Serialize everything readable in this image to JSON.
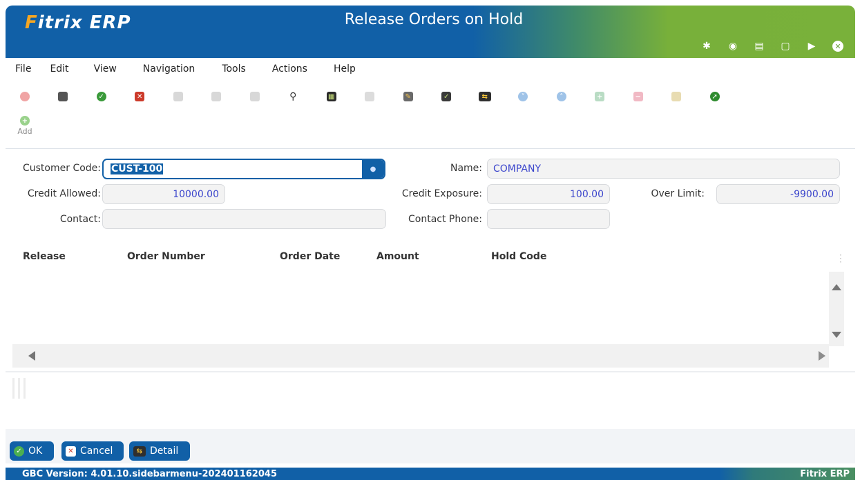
{
  "app": {
    "logo_part1": "F",
    "logo_part2": "itrix ERP",
    "window_title": "Release Orders on Hold"
  },
  "titlebar_icons": [
    "gear-icon",
    "target-icon",
    "document-icon",
    "page-icon",
    "play-icon",
    "close-icon"
  ],
  "menu": {
    "items": [
      "File",
      "Edit",
      "View",
      "Navigation",
      "Tools",
      "Actions",
      "Help"
    ]
  },
  "toolbar": {
    "icons": [
      {
        "name": "cancel-disabled-icon",
        "color": "#f0a4a4"
      },
      {
        "name": "window-icon",
        "color": "#444"
      },
      {
        "name": "accept-icon",
        "color": "#3a9a3a"
      },
      {
        "name": "cancel-icon",
        "color": "#cc3a2a"
      },
      {
        "name": "copy-icon",
        "color": "#c9c9c9"
      },
      {
        "name": "paste-icon",
        "color": "#c9c9c9"
      },
      {
        "name": "grid-icon",
        "color": "#c9c9c9"
      },
      {
        "name": "search-icon",
        "color": "#333"
      },
      {
        "name": "calendar-icon",
        "color": "#222"
      },
      {
        "name": "file-icon",
        "color": "#c9c9c9"
      },
      {
        "name": "note-icon",
        "color": "#444"
      },
      {
        "name": "checklist-icon",
        "color": "#333"
      },
      {
        "name": "toggle-icon",
        "color": "#3a3a3a"
      },
      {
        "name": "scroll-down-icon",
        "color": "#9fc3e8"
      },
      {
        "name": "scroll-up-icon",
        "color": "#9fc3e8"
      },
      {
        "name": "flow-add-icon",
        "color": "#a9d9a9"
      },
      {
        "name": "flow-remove-icon",
        "color": "#f1a9b9"
      },
      {
        "name": "stack-icon",
        "color": "#e3d29f"
      },
      {
        "name": "export-icon",
        "color": "#2e8b2e"
      }
    ],
    "add_label": "Add"
  },
  "form": {
    "customer_code_label": "Customer Code:",
    "customer_code_value": "CUST-100",
    "name_label": "Name:",
    "name_value": "COMPANY",
    "credit_allowed_label": "Credit Allowed:",
    "credit_allowed_value": "10000.00",
    "credit_exposure_label": "Credit Exposure:",
    "credit_exposure_value": "100.00",
    "over_limit_label": "Over Limit:",
    "over_limit_value": "-9900.00",
    "contact_label": "Contact:",
    "contact_value": "",
    "contact_phone_label": "Contact Phone:",
    "contact_phone_value": ""
  },
  "grid": {
    "columns": [
      "Release",
      "Order Number",
      "Order Date",
      "Amount",
      "Hold Code"
    ],
    "rows": []
  },
  "buttons": {
    "ok": "OK",
    "cancel": "Cancel",
    "detail": "Detail"
  },
  "status": {
    "version": "GBC Version: 4.01.10.sidebarmenu-202401162045",
    "app_name": "Fitrix ERP"
  }
}
